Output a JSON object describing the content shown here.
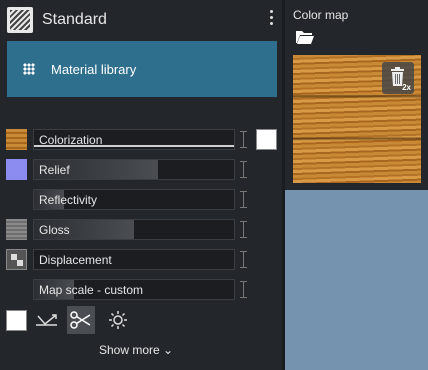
{
  "header": {
    "title": "Standard"
  },
  "library": {
    "label": "Material library"
  },
  "channels": [
    {
      "label": "Colorization",
      "fill": 0,
      "swatch": "wood"
    },
    {
      "label": "Relief",
      "fill": 0.62,
      "swatch": "blue"
    },
    {
      "label": "Reflectivity",
      "fill": 0.15,
      "swatch": "none"
    },
    {
      "label": "Gloss",
      "fill": 0.5,
      "swatch": "gray"
    },
    {
      "label": "Displacement",
      "fill": 0,
      "swatch": "checker"
    },
    {
      "label": "Map scale - custom",
      "fill": 0.2,
      "swatch": "none"
    }
  ],
  "footer": {
    "show_more": "Show more ⌄"
  },
  "color_map": {
    "title": "Color map",
    "delete_badge": "2x"
  },
  "colors": {
    "accent": "#2f6f8e",
    "panel": "#23272b",
    "viewport": "#7593ae"
  }
}
